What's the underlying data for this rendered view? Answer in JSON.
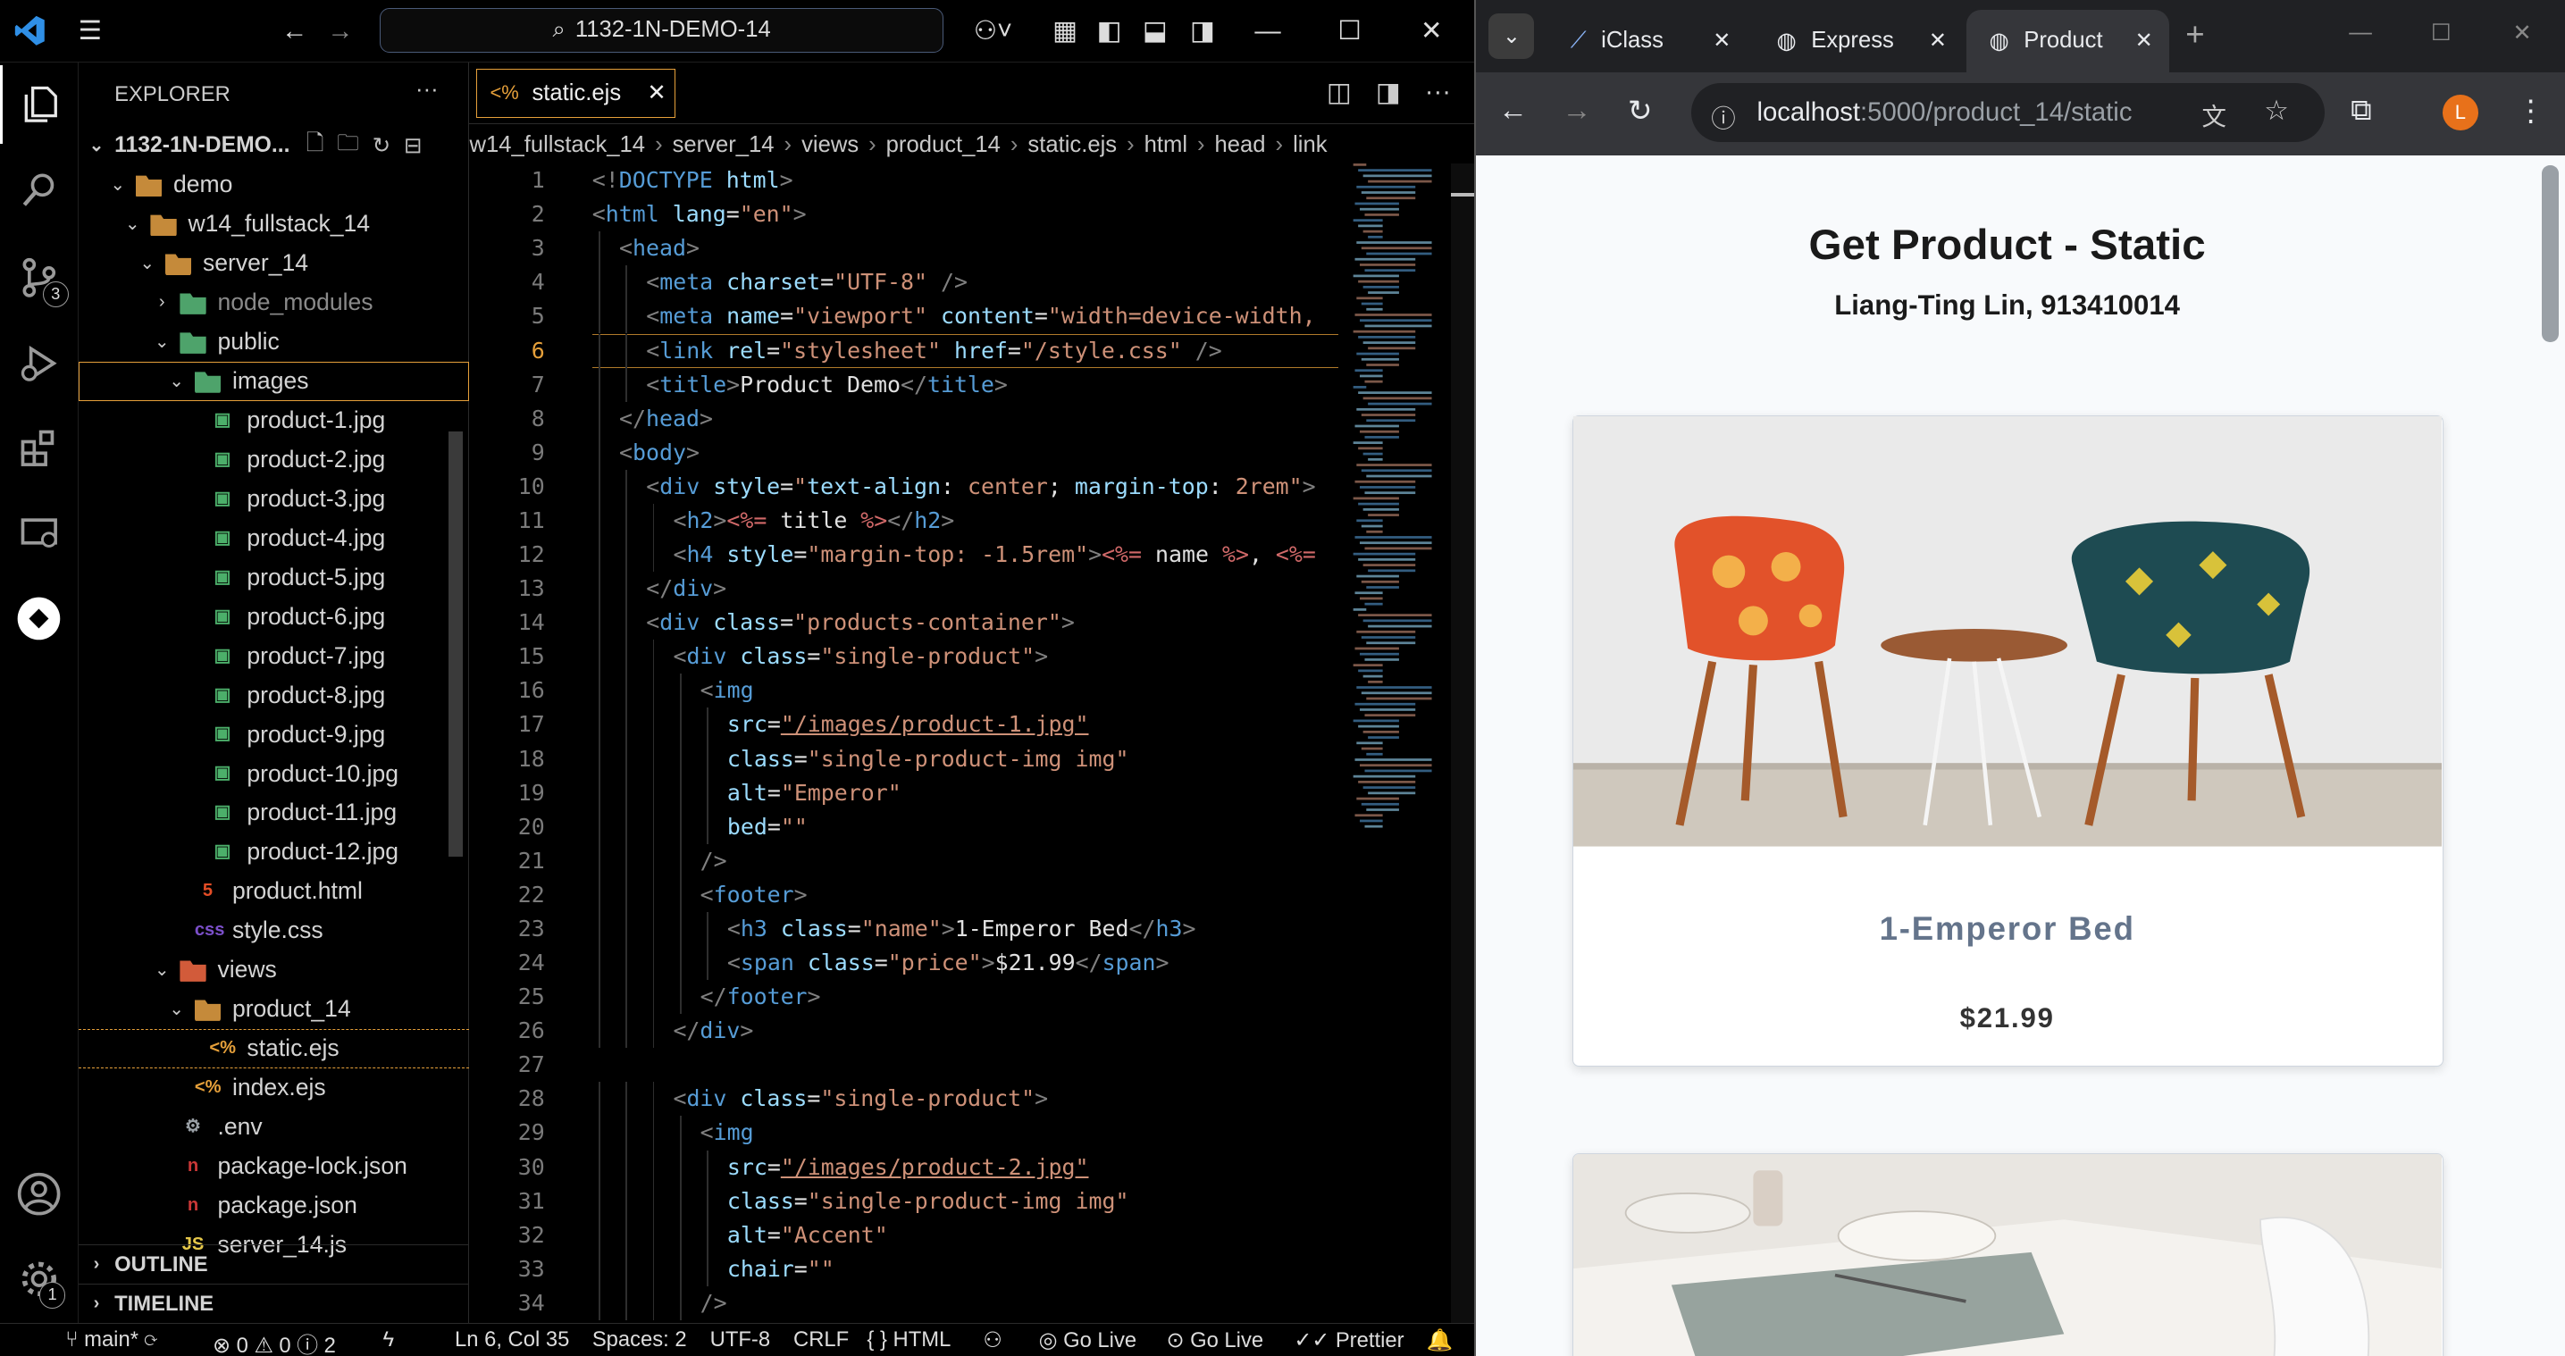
{
  "vscode": {
    "search_text": "1132-1N-DEMO-14",
    "explorer_title": "EXPLORER",
    "explorer_more": "···",
    "workspace": "1132-1N-DEMO...",
    "tree": [
      {
        "label": "demo",
        "depth": 1,
        "type": "folder",
        "open": true
      },
      {
        "label": "w14_fullstack_14",
        "depth": 2,
        "type": "folder",
        "open": true
      },
      {
        "label": "server_14",
        "depth": 3,
        "type": "folder",
        "open": true
      },
      {
        "label": "node_modules",
        "depth": 4,
        "type": "folder-green",
        "open": false
      },
      {
        "label": "public",
        "depth": 4,
        "type": "folder-green",
        "open": true
      },
      {
        "label": "images",
        "depth": 5,
        "type": "folder-img",
        "open": true,
        "selected": true
      },
      {
        "label": "product-1.jpg",
        "depth": 6,
        "type": "image"
      },
      {
        "label": "product-2.jpg",
        "depth": 6,
        "type": "image"
      },
      {
        "label": "product-3.jpg",
        "depth": 6,
        "type": "image"
      },
      {
        "label": "product-4.jpg",
        "depth": 6,
        "type": "image"
      },
      {
        "label": "product-5.jpg",
        "depth": 6,
        "type": "image"
      },
      {
        "label": "product-6.jpg",
        "depth": 6,
        "type": "image"
      },
      {
        "label": "product-7.jpg",
        "depth": 6,
        "type": "image"
      },
      {
        "label": "product-8.jpg",
        "depth": 6,
        "type": "image"
      },
      {
        "label": "product-9.jpg",
        "depth": 6,
        "type": "image"
      },
      {
        "label": "product-10.jpg",
        "depth": 6,
        "type": "image"
      },
      {
        "label": "product-11.jpg",
        "depth": 6,
        "type": "image"
      },
      {
        "label": "product-12.jpg",
        "depth": 6,
        "type": "image"
      },
      {
        "label": "product.html",
        "depth": 5,
        "type": "html"
      },
      {
        "label": "style.css",
        "depth": 5,
        "type": "css"
      },
      {
        "label": "views",
        "depth": 4,
        "type": "folder-red",
        "open": true
      },
      {
        "label": "product_14",
        "depth": 5,
        "type": "folder",
        "open": true
      },
      {
        "label": "static.ejs",
        "depth": 6,
        "type": "ejs",
        "active": true
      },
      {
        "label": "index.ejs",
        "depth": 5,
        "type": "ejs"
      },
      {
        "label": ".env",
        "depth": 4,
        "type": "gear"
      },
      {
        "label": "package-lock.json",
        "depth": 4,
        "type": "npm"
      },
      {
        "label": "package.json",
        "depth": 4,
        "type": "npm"
      },
      {
        "label": "server_14.js",
        "depth": 4,
        "type": "js"
      }
    ],
    "outline_label": "OUTLINE",
    "timeline_label": "TIMELINE",
    "tab_label": "static.ejs",
    "breadcrumbs": [
      "w14_fullstack_14",
      "server_14",
      "views",
      "product_14",
      "static.ejs",
      "html",
      "head",
      "link"
    ],
    "code_lines": [
      "1",
      "2",
      "3",
      "4",
      "5",
      "6",
      "7",
      "8",
      "9",
      "10",
      "11",
      "12",
      "13",
      "14",
      "15",
      "16",
      "17",
      "18",
      "19",
      "20",
      "21",
      "22",
      "23",
      "24",
      "25",
      "26",
      "27",
      "28",
      "29",
      "30",
      "31",
      "32",
      "33",
      "34"
    ],
    "status": {
      "branch": "main*",
      "errors": "0",
      "warnings": "0",
      "info": "2",
      "position": "Ln 6, Col 35",
      "spaces": "Spaces: 2",
      "encoding": "UTF-8",
      "eol": "CRLF",
      "language": "HTML",
      "golive1": "Go Live",
      "golive2": "Go Live",
      "prettier": "Prettier"
    },
    "badges": {
      "scm": "3",
      "account": "1"
    }
  },
  "browser": {
    "tabs": [
      "iClass",
      "Express",
      "Product"
    ],
    "url_host": "localhost",
    "url_path": ":5000/product_14/static",
    "profile_initial": "L",
    "page_title": "Get Product - Static",
    "page_subtitle": "Liang-Ting Lin, 913410014",
    "products": [
      {
        "name": "1-Emperor Bed",
        "price": "$21.99"
      }
    ]
  },
  "colors": {
    "accent": "#e6a03a",
    "link": "#569cd6",
    "string": "#ce9178",
    "attr": "#9cdcfe"
  }
}
